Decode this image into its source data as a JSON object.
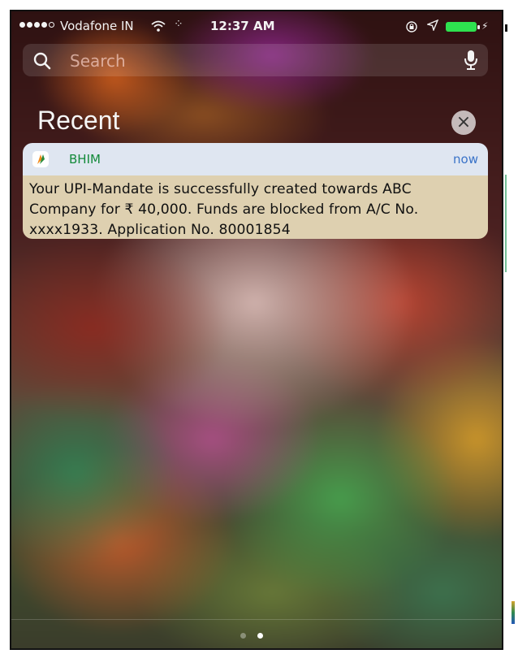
{
  "status_bar": {
    "carrier": "Vodafone IN",
    "time": "12:37 AM",
    "signal_bars": 4,
    "signal_total": 5,
    "battery_level": 1.0,
    "battery_color": "#2ee24f"
  },
  "search": {
    "placeholder": "Search",
    "icons": [
      "search-icon",
      "mic-icon"
    ]
  },
  "recent": {
    "heading": "Recent",
    "clear_label": "×"
  },
  "notification": {
    "app_name": "BHIM",
    "time": "now",
    "body": "Your UPI-Mandate is successfully created towards ABC Company for ₹ 40,000. Funds are blocked from A/C No. xxxx1933. Application No. 80001854",
    "colors": {
      "header_bg": "#dfe6f1",
      "body_bg": "#ded0b0",
      "app_name": "#138a3a",
      "time": "#3a73c8"
    }
  },
  "page_indicator": {
    "total": 2,
    "current": 2
  }
}
